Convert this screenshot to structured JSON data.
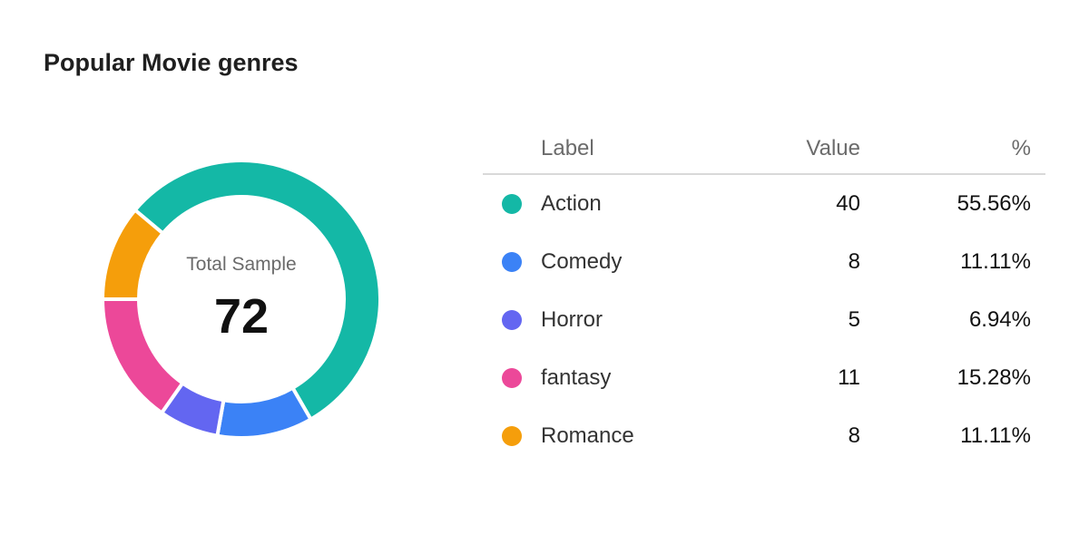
{
  "title": "Popular Movie genres",
  "center": {
    "label": "Total Sample",
    "value": "72"
  },
  "table": {
    "headers": {
      "label": "Label",
      "value": "Value",
      "pct": "%"
    }
  },
  "chart_data": {
    "type": "pie",
    "donut": true,
    "categories": [
      "Action",
      "Comedy",
      "Horror",
      "fantasy",
      "Romance"
    ],
    "values": [
      40,
      8,
      5,
      11,
      8
    ],
    "percentages": [
      "55.56%",
      "11.11%",
      "6.94%",
      "15.28%",
      "11.11%"
    ],
    "colors": [
      "#14b8a6",
      "#3b82f6",
      "#6366f1",
      "#ec4899",
      "#f59e0b"
    ],
    "total": 72,
    "legend": "right"
  }
}
